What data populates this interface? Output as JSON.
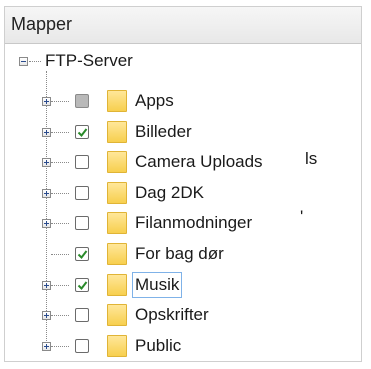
{
  "panel": {
    "title": "Mapper"
  },
  "root": {
    "label": "FTP-Server",
    "expanded": true
  },
  "items": [
    {
      "label": "Apps",
      "check": "partial",
      "expandable": true
    },
    {
      "label": "Billeder",
      "check": "checked",
      "expandable": true
    },
    {
      "label": "Camera Uploads",
      "check": "unchecked",
      "expandable": true,
      "trailing": "ls"
    },
    {
      "label": "Dag 2DK",
      "check": "unchecked",
      "expandable": true
    },
    {
      "label": "Filanmodninger",
      "check": "unchecked",
      "expandable": true,
      "trailing": "'"
    },
    {
      "label": "For bag dør",
      "check": "checked",
      "expandable": false
    },
    {
      "label": "Musik",
      "check": "checked",
      "expandable": true,
      "selected": true
    },
    {
      "label": "Opskrifter",
      "check": "unchecked",
      "expandable": true
    },
    {
      "label": "Public",
      "check": "unchecked",
      "expandable": true
    }
  ],
  "colors": {
    "folder": "#f7cf4e",
    "check": "#2a8a2a",
    "selection": "#7fb2e8"
  },
  "icons": {
    "expand": "plus-expander-icon",
    "collapse": "minus-expander-icon",
    "folder": "folder-icon",
    "check": "checkmark-icon"
  }
}
